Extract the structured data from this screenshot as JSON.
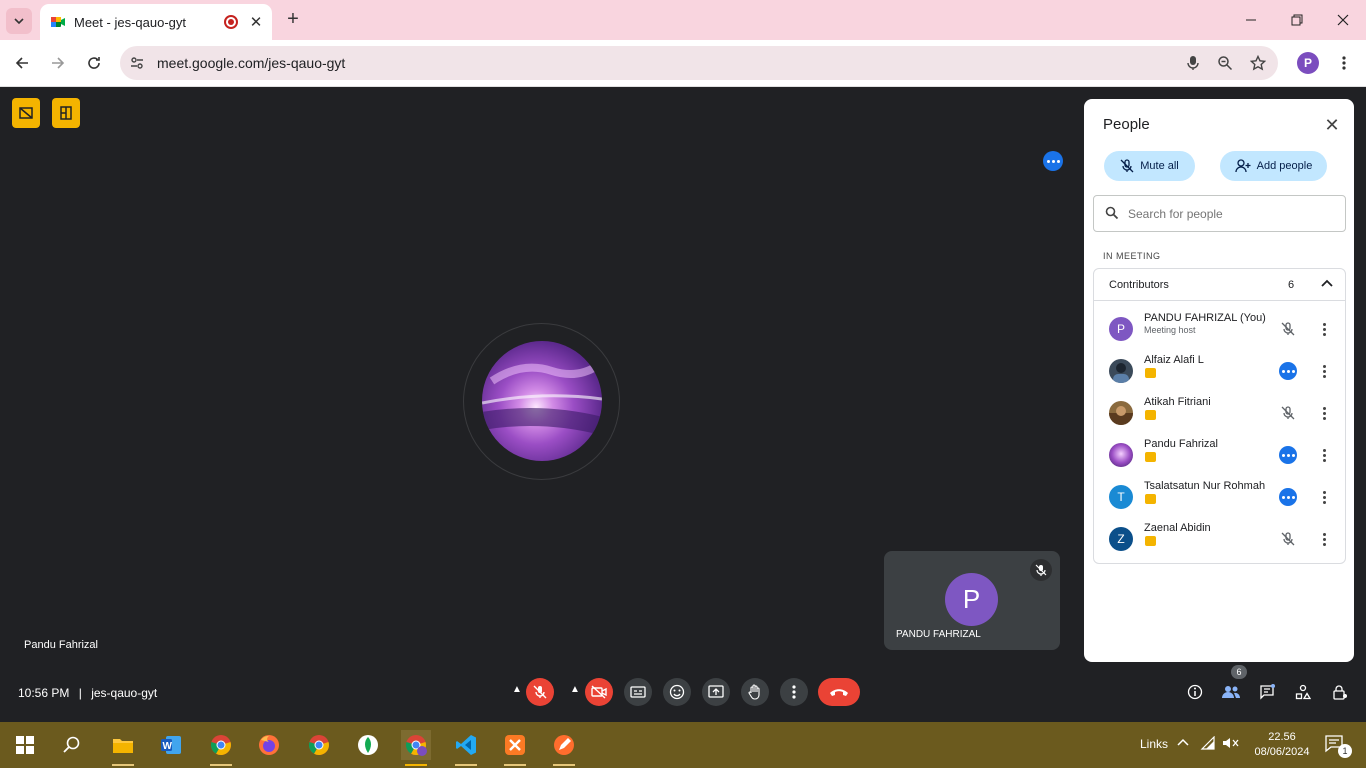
{
  "browser": {
    "tab": {
      "title": "Meet - jes-qauo-gyt"
    },
    "url": "meet.google.com/jes-qauo-gyt",
    "profile_initial": "P"
  },
  "meeting": {
    "code": "jes-qauo-gyt",
    "time": "10:56 PM",
    "separator": "|",
    "main_tile_name": "Pandu Fahrizal",
    "self_tile": {
      "initial": "P",
      "name": "PANDU FAHRIZAL"
    }
  },
  "people_panel": {
    "title": "People",
    "mute_all": "Mute all",
    "add_people": "Add people",
    "search_placeholder": "Search for people",
    "section_label": "IN MEETING",
    "group": {
      "label": "Contributors",
      "count": "6"
    },
    "participants": [
      {
        "name": "PANDU FAHRIZAL (You)",
        "subtitle": "Meeting host",
        "initial": "P",
        "avatar_color": "#7e57c2",
        "status": "muted"
      },
      {
        "name": "Alfaiz Alafi L",
        "subtitle": "",
        "initial": "",
        "avatar_color": "#3b4a5a",
        "status": "more"
      },
      {
        "name": "Atikah Fitriani",
        "subtitle": "",
        "initial": "",
        "avatar_color": "#8a6a3e",
        "status": "muted"
      },
      {
        "name": "Pandu Fahrizal",
        "subtitle": "",
        "initial": "",
        "avatar_color": "#8e44ad",
        "status": "more"
      },
      {
        "name": "Tsalatsatun Nur Rohmah",
        "subtitle": "",
        "initial": "T",
        "avatar_color": "#1a8ad4",
        "status": "more"
      },
      {
        "name": "Zaenal Abidin",
        "subtitle": "",
        "initial": "Z",
        "avatar_color": "#0b4f8a",
        "status": "muted"
      }
    ]
  },
  "controls": {
    "people_count": "6"
  },
  "taskbar": {
    "links_label": "Links",
    "time": "22.56",
    "date": "08/06/2024",
    "notification_count": "1"
  },
  "colors": {
    "accent": "#1a73e8",
    "danger": "#ea4335",
    "warning": "#f4b400",
    "panel_pill": "#c2e7ff"
  }
}
